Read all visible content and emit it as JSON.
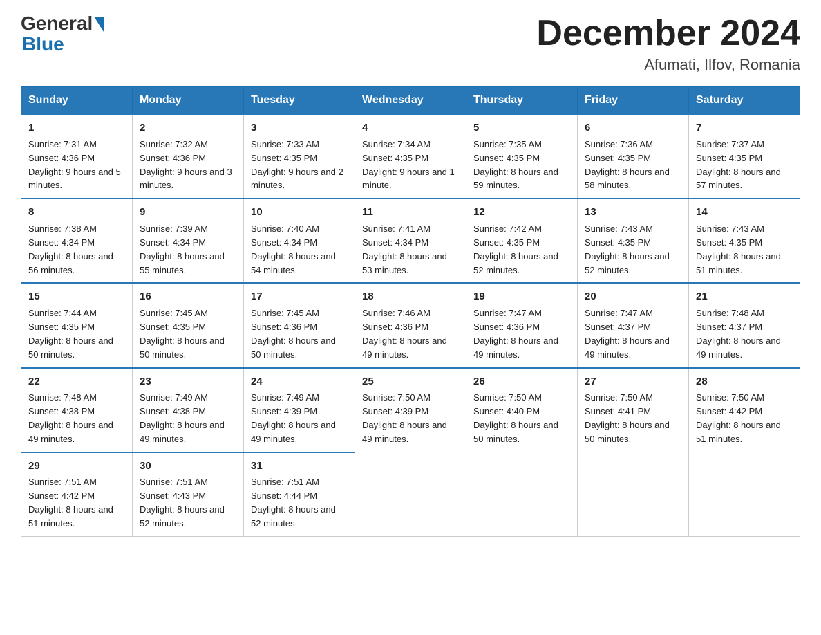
{
  "header": {
    "logo_general": "General",
    "logo_blue": "Blue",
    "title": "December 2024",
    "subtitle": "Afumati, Ilfov, Romania"
  },
  "weekdays": [
    "Sunday",
    "Monday",
    "Tuesday",
    "Wednesday",
    "Thursday",
    "Friday",
    "Saturday"
  ],
  "weeks": [
    [
      {
        "day": "1",
        "sunrise": "7:31 AM",
        "sunset": "4:36 PM",
        "daylight": "9 hours and 5 minutes."
      },
      {
        "day": "2",
        "sunrise": "7:32 AM",
        "sunset": "4:36 PM",
        "daylight": "9 hours and 3 minutes."
      },
      {
        "day": "3",
        "sunrise": "7:33 AM",
        "sunset": "4:35 PM",
        "daylight": "9 hours and 2 minutes."
      },
      {
        "day": "4",
        "sunrise": "7:34 AM",
        "sunset": "4:35 PM",
        "daylight": "9 hours and 1 minute."
      },
      {
        "day": "5",
        "sunrise": "7:35 AM",
        "sunset": "4:35 PM",
        "daylight": "8 hours and 59 minutes."
      },
      {
        "day": "6",
        "sunrise": "7:36 AM",
        "sunset": "4:35 PM",
        "daylight": "8 hours and 58 minutes."
      },
      {
        "day": "7",
        "sunrise": "7:37 AM",
        "sunset": "4:35 PM",
        "daylight": "8 hours and 57 minutes."
      }
    ],
    [
      {
        "day": "8",
        "sunrise": "7:38 AM",
        "sunset": "4:34 PM",
        "daylight": "8 hours and 56 minutes."
      },
      {
        "day": "9",
        "sunrise": "7:39 AM",
        "sunset": "4:34 PM",
        "daylight": "8 hours and 55 minutes."
      },
      {
        "day": "10",
        "sunrise": "7:40 AM",
        "sunset": "4:34 PM",
        "daylight": "8 hours and 54 minutes."
      },
      {
        "day": "11",
        "sunrise": "7:41 AM",
        "sunset": "4:34 PM",
        "daylight": "8 hours and 53 minutes."
      },
      {
        "day": "12",
        "sunrise": "7:42 AM",
        "sunset": "4:35 PM",
        "daylight": "8 hours and 52 minutes."
      },
      {
        "day": "13",
        "sunrise": "7:43 AM",
        "sunset": "4:35 PM",
        "daylight": "8 hours and 52 minutes."
      },
      {
        "day": "14",
        "sunrise": "7:43 AM",
        "sunset": "4:35 PM",
        "daylight": "8 hours and 51 minutes."
      }
    ],
    [
      {
        "day": "15",
        "sunrise": "7:44 AM",
        "sunset": "4:35 PM",
        "daylight": "8 hours and 50 minutes."
      },
      {
        "day": "16",
        "sunrise": "7:45 AM",
        "sunset": "4:35 PM",
        "daylight": "8 hours and 50 minutes."
      },
      {
        "day": "17",
        "sunrise": "7:45 AM",
        "sunset": "4:36 PM",
        "daylight": "8 hours and 50 minutes."
      },
      {
        "day": "18",
        "sunrise": "7:46 AM",
        "sunset": "4:36 PM",
        "daylight": "8 hours and 49 minutes."
      },
      {
        "day": "19",
        "sunrise": "7:47 AM",
        "sunset": "4:36 PM",
        "daylight": "8 hours and 49 minutes."
      },
      {
        "day": "20",
        "sunrise": "7:47 AM",
        "sunset": "4:37 PM",
        "daylight": "8 hours and 49 minutes."
      },
      {
        "day": "21",
        "sunrise": "7:48 AM",
        "sunset": "4:37 PM",
        "daylight": "8 hours and 49 minutes."
      }
    ],
    [
      {
        "day": "22",
        "sunrise": "7:48 AM",
        "sunset": "4:38 PM",
        "daylight": "8 hours and 49 minutes."
      },
      {
        "day": "23",
        "sunrise": "7:49 AM",
        "sunset": "4:38 PM",
        "daylight": "8 hours and 49 minutes."
      },
      {
        "day": "24",
        "sunrise": "7:49 AM",
        "sunset": "4:39 PM",
        "daylight": "8 hours and 49 minutes."
      },
      {
        "day": "25",
        "sunrise": "7:50 AM",
        "sunset": "4:39 PM",
        "daylight": "8 hours and 49 minutes."
      },
      {
        "day": "26",
        "sunrise": "7:50 AM",
        "sunset": "4:40 PM",
        "daylight": "8 hours and 50 minutes."
      },
      {
        "day": "27",
        "sunrise": "7:50 AM",
        "sunset": "4:41 PM",
        "daylight": "8 hours and 50 minutes."
      },
      {
        "day": "28",
        "sunrise": "7:50 AM",
        "sunset": "4:42 PM",
        "daylight": "8 hours and 51 minutes."
      }
    ],
    [
      {
        "day": "29",
        "sunrise": "7:51 AM",
        "sunset": "4:42 PM",
        "daylight": "8 hours and 51 minutes."
      },
      {
        "day": "30",
        "sunrise": "7:51 AM",
        "sunset": "4:43 PM",
        "daylight": "8 hours and 52 minutes."
      },
      {
        "day": "31",
        "sunrise": "7:51 AM",
        "sunset": "4:44 PM",
        "daylight": "8 hours and 52 minutes."
      },
      null,
      null,
      null,
      null
    ]
  ]
}
